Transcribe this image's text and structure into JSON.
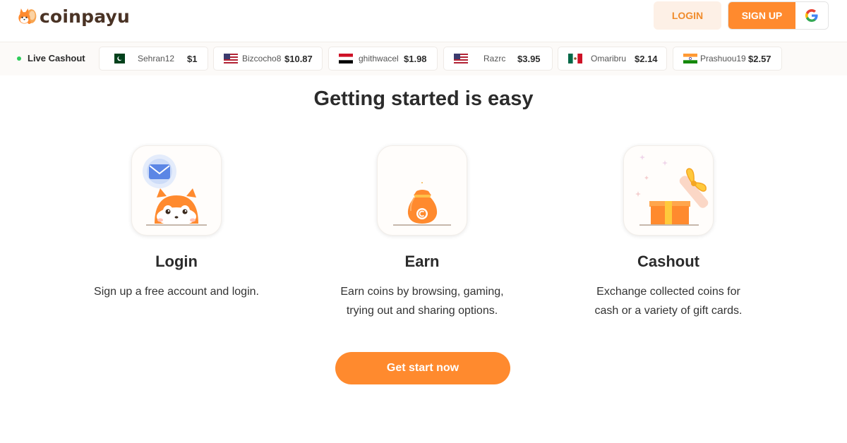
{
  "header": {
    "brand": "coinpayu",
    "login_label": "LOGIN",
    "signup_label": "SIGN UP",
    "google_letter": "G"
  },
  "ticker": {
    "label": "Live Cashout",
    "items": [
      {
        "flag": "pakistan",
        "name": "Sehran12",
        "amount": "$1"
      },
      {
        "flag": "united-states",
        "name": "Bizcocho8",
        "amount": "$10.87"
      },
      {
        "flag": "yemen",
        "name": "ghithwacel",
        "amount": "$1.98"
      },
      {
        "flag": "united-states",
        "name": "Razrc",
        "amount": "$3.95"
      },
      {
        "flag": "mexico",
        "name": "Omaribru",
        "amount": "$2.14"
      },
      {
        "flag": "india",
        "name": "Prashuou19",
        "amount": "$2.57"
      }
    ]
  },
  "main": {
    "title": "Getting started is easy",
    "steps": [
      {
        "icon": "squirrel-mail-icon",
        "title": "Login",
        "desc": "Sign up a free account and login."
      },
      {
        "icon": "coin-bag-icon",
        "title": "Earn",
        "desc": "Earn coins by browsing, gaming, trying out and sharing options."
      },
      {
        "icon": "gift-box-icon",
        "title": "Cashout",
        "desc": "Exchange collected coins for cash or a variety of gift cards."
      }
    ],
    "cta_label": "Get start now"
  },
  "colors": {
    "brand_orange": "#ff8a2e",
    "login_bg": "#fdf0e6",
    "live_dot": "#2ecc5a"
  }
}
